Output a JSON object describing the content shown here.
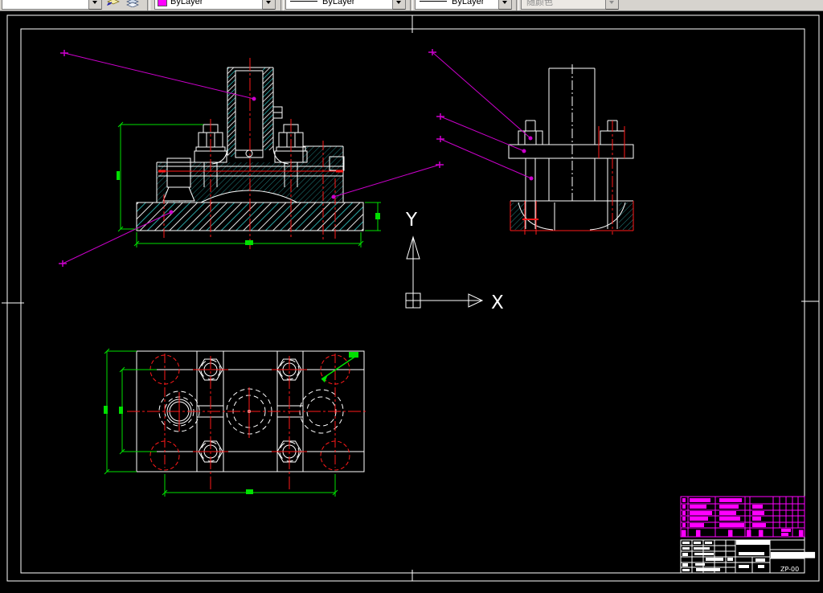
{
  "toolbar": {
    "layer_dropdown_value": "",
    "color_value": "ByLayer",
    "color_swatch": "#FF00FF",
    "linetype_value": "ByLayer",
    "lineweight_value": "ByLayer",
    "plot_style_value": "随颜色"
  },
  "ucs": {
    "x_label": "X",
    "y_label": "Y"
  },
  "title_block": {
    "drawing_title": "███████████",
    "drawing_number": "ZP-00",
    "bom_headers": [
      "█",
      "█",
      "█",
      "█",
      "█",
      "█"
    ]
  },
  "colors": {
    "background": "#000000",
    "line": "#FFFFFF",
    "centerline": "#FF0000",
    "dimension": "#00FF00",
    "leader": "#CC00CC",
    "hatch": "#33CCCC",
    "toolbar_bg": "#D6D3CE"
  }
}
